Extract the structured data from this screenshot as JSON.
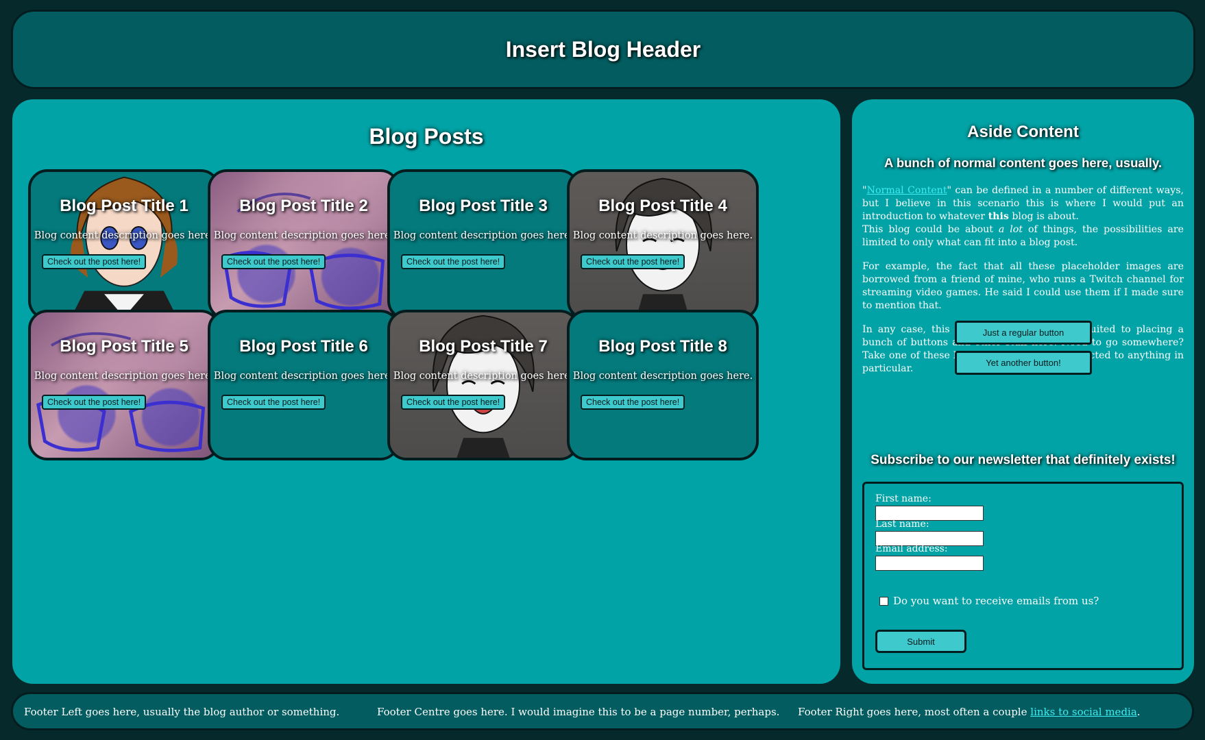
{
  "header": {
    "title": "Insert Blog Header"
  },
  "main": {
    "title": "Blog Posts",
    "posts": [
      {
        "title": "Blog Post Title 1",
        "description": "Blog content description goes here.",
        "button": "Check out the post here!",
        "image": "anime-character-brown-hair"
      },
      {
        "title": "Blog Post Title 2",
        "description": "Blog content description goes here.",
        "button": "Check out the post here!",
        "image": "galaxy-glasses-closeup"
      },
      {
        "title": "Blog Post Title 3",
        "description": "Blog content description goes here.",
        "button": "Check out the post here!",
        "image": "none"
      },
      {
        "title": "Blog Post Title 4",
        "description": "Blog content description goes here.",
        "button": "Check out the post here!",
        "image": "grayscale-smiling-character"
      },
      {
        "title": "Blog Post Title 5",
        "description": "Blog content description goes here.",
        "button": "Check out the post here!",
        "image": "galaxy-glasses-closeup"
      },
      {
        "title": "Blog Post Title 6",
        "description": "Blog content description goes here.",
        "button": "Check out the post here!",
        "image": "none"
      },
      {
        "title": "Blog Post Title 7",
        "description": "Blog content description goes here.",
        "button": "Check out the post here!",
        "image": "grayscale-smiling-character"
      },
      {
        "title": "Blog Post Title 8",
        "description": "Blog content description goes here.",
        "button": "Check out the post here!",
        "image": "none"
      }
    ]
  },
  "aside": {
    "title": "Aside Content",
    "subtitle": "A bunch of normal content goes here, usually.",
    "para1": {
      "quote_open": "\"",
      "link": "Normal Content",
      "text_a": "\" can be defined in a number of different ways, but I believe in this scenario this is where I would put an introduction to whatever ",
      "bold": "this",
      "text_b": " blog is about.",
      "line2_a": "This blog could be about ",
      "italic": "a lot",
      "line2_b": " of things, the possibilities are limited to only what can fit into a blog post."
    },
    "para2": "For example, the fact that all these placeholder images are borrowed from a friend of mine, who runs a Twitch channel for streaming video games. He said I could use them if I made sure to mention that.",
    "para3": "In any case, this section is probably best suited to placing a bunch of buttons and other stuff here. Need to go somewhere? Take one of these buttons which aren't connected to anything in particular.",
    "button1": "Just a regular button",
    "button2": "Yet another button!",
    "newsletter": {
      "title": "Subscribe to our newsletter that definitely exists!",
      "first_name": "First name:",
      "last_name": "Last name:",
      "email": "Email address:",
      "checkbox_label": "Do you want to receive emails from us?",
      "submit": "Submit"
    }
  },
  "footer": {
    "left": "Footer Left goes here, usually the blog author or something.",
    "centre": "Footer Centre goes here. I would imagine this to be a page number, perhaps.",
    "right_text": "Footer Right goes here, most often a couple ",
    "right_link": "links to social media",
    "right_end": "."
  },
  "colors": {
    "background": "#06292b",
    "header": "#035d60",
    "panel": "#02a3a6",
    "card": "#047a7c",
    "button": "#3ec9cc",
    "link": "#3cecf0",
    "border": "#031c1d"
  }
}
